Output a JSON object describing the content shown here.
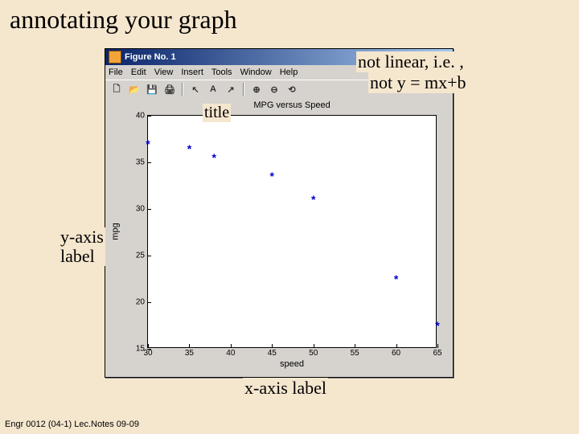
{
  "slide_title": "annotating your graph",
  "footer": "Engr 0012 (04-1) Lec.Notes 09-09",
  "annotations": {
    "title_callout": "title",
    "yaxis_callout": "y-axis label",
    "xaxis_callout": "x-axis label",
    "nonlinear_line1": "not linear, i.e. ,",
    "nonlinear_line2": "not  y = mx+b"
  },
  "figure": {
    "window_title": "Figure No. 1",
    "menus": [
      "File",
      "Edit",
      "View",
      "Insert",
      "Tools",
      "Window",
      "Help"
    ],
    "toolbar_icons": [
      "new-icon",
      "open-icon",
      "save-icon",
      "print-icon",
      "arrow-icon",
      "text-icon",
      "draw-icon",
      "zoomin-icon",
      "zoomout-icon",
      "rotate-icon"
    ],
    "chart_title": "MPG versus Speed",
    "xlabel": "speed",
    "ylabel": "mpg"
  },
  "chart_data": {
    "type": "scatter",
    "title": "MPG versus Speed",
    "xlabel": "speed",
    "ylabel": "mpg",
    "xlim": [
      30,
      65
    ],
    "ylim": [
      15,
      40
    ],
    "xticks": [
      30,
      35,
      40,
      45,
      50,
      55,
      60,
      65
    ],
    "yticks": [
      15,
      20,
      25,
      30,
      35,
      40
    ],
    "x": [
      30,
      35,
      38,
      45,
      50,
      60,
      65
    ],
    "y": [
      37,
      36.5,
      35.5,
      33.5,
      31,
      22.5,
      17.5
    ],
    "marker": "*"
  }
}
